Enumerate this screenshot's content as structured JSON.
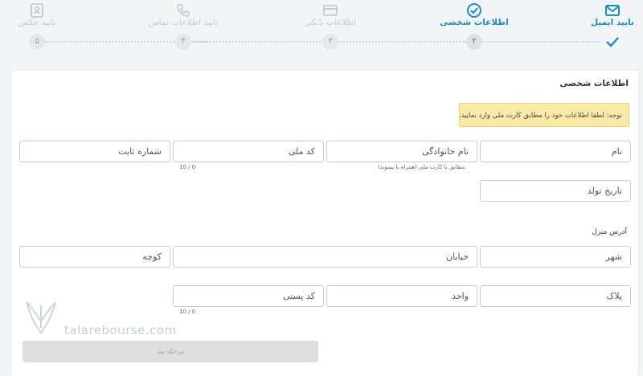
{
  "stepper": {
    "steps": [
      {
        "label": "تایید ایمیل",
        "dot": "",
        "state": "done",
        "icon": "envelope-icon"
      },
      {
        "label": "اطلاعات شخصی",
        "dot": "۲",
        "state": "active",
        "icon": "check-circle-icon"
      },
      {
        "label": "اطلاعات بانکی",
        "dot": "۳",
        "state": "pending",
        "icon": "card-icon"
      },
      {
        "label": "تایید اطلاعات تماس",
        "dot": "۴",
        "state": "pending",
        "icon": "phone-icon"
      },
      {
        "label": "تایید عکس",
        "dot": "۵",
        "state": "pending",
        "icon": "id-card-icon"
      }
    ]
  },
  "form": {
    "title": "اطلاعات شخصی",
    "notice": "توجه: لطفا اطلاعات خود را مطابق کارت ملی وارد نمایید.",
    "fields": {
      "first_name": "نام",
      "last_name": "نام خانوادگی",
      "last_name_hint": "مطابق با کارت ملی (همراه با پسوند)",
      "national_code": "کد ملی",
      "national_code_counter": "10 / 0",
      "phone": "شماره ثابت",
      "birth_date": "تاریخ تولد",
      "city": "شهر",
      "street": "خیابان",
      "alley": "کوچه",
      "plaque": "پلاک",
      "unit": "واحد",
      "postal_code": "کد پستی",
      "postal_code_counter": "10 / 0"
    },
    "address_label": "آدرس منزل",
    "next_button": "مرحله بعد"
  },
  "watermark": {
    "text": "talarebourse.com"
  },
  "colors": {
    "accent": "#1a8fc2",
    "notice_bg": "#fbe9a8",
    "page_bg": "#f3f4f6"
  }
}
